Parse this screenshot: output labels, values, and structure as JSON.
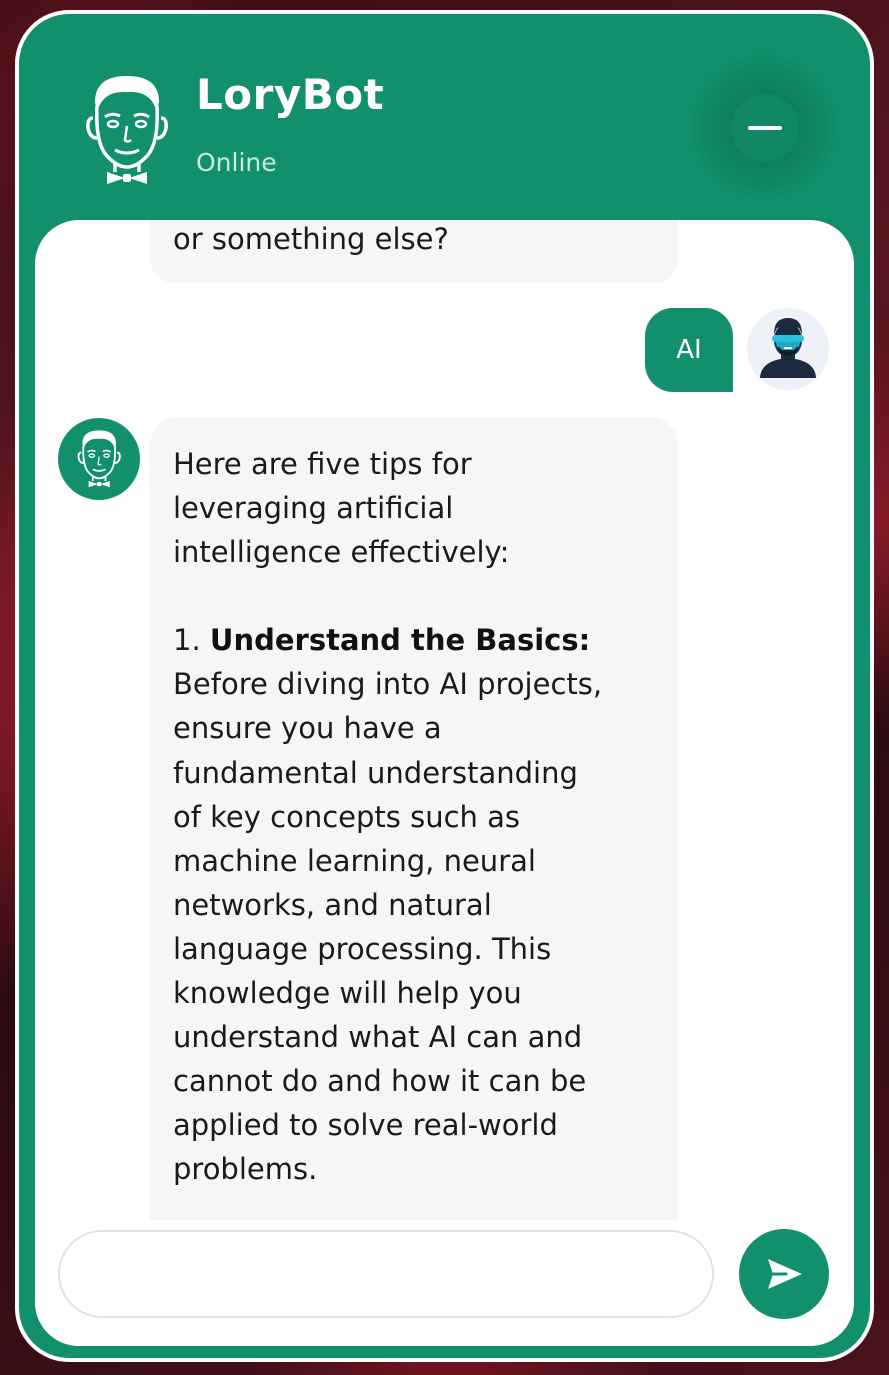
{
  "header": {
    "bot_name": "LoryBot",
    "status": "Online",
    "bot_avatar_icon": "bot-face-icon",
    "minimize_icon": "minus-icon"
  },
  "messages": [
    {
      "sender": "bot",
      "lines": [
        "or something else?"
      ]
    },
    {
      "sender": "user",
      "text": "AI",
      "avatar_icon": "user-avatar-icon"
    },
    {
      "sender": "bot",
      "intro": [
        "Here are five tips for",
        "leveraging artificial",
        "intelligence effectively:"
      ],
      "tip_number": "1.",
      "tip_title": "Understand the Basics:",
      "tip_body": [
        "Before diving into AI projects,",
        "ensure you have a",
        "fundamental understanding",
        "of key concepts such as",
        "machine learning, neural",
        "networks, and natural",
        "language processing. This",
        "knowledge will help you",
        "understand what AI can and",
        "cannot do and how it can be",
        "applied to solve real-world",
        "problems."
      ]
    }
  ],
  "composer": {
    "value": "",
    "placeholder": "",
    "send_icon": "send-icon"
  },
  "colors": {
    "brand": "#12906d",
    "bubble_bot": "#f6f6f6",
    "bubble_user": "#12906d",
    "text": "#1a1a1a"
  }
}
